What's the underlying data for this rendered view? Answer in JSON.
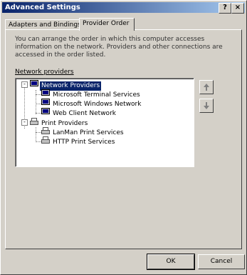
{
  "window": {
    "title": "Advanced Settings",
    "help_label": "?",
    "close_label": "×"
  },
  "tabs": [
    {
      "label": "Adapters and Bindings",
      "active": false
    },
    {
      "label": "Provider Order",
      "active": true
    }
  ],
  "description": "You can arrange the order in which this computer accesses information on the network. Providers and other connections are accessed in the order listed.",
  "list_label": "Network providers",
  "tree": {
    "groups": [
      {
        "label": "Network Providers",
        "expander": "-",
        "icon": "network-providers-icon",
        "selected": true,
        "children": [
          {
            "label": "Microsoft Terminal Services",
            "icon": "network-icon"
          },
          {
            "label": "Microsoft Windows Network",
            "icon": "network-icon"
          },
          {
            "label": "Web Client Network",
            "icon": "network-icon"
          }
        ]
      },
      {
        "label": "Print Providers",
        "expander": "-",
        "icon": "printer-icon",
        "selected": false,
        "children": [
          {
            "label": "LanMan Print Services",
            "icon": "printer-icon"
          },
          {
            "label": "HTTP Print Services",
            "icon": "printer-icon"
          }
        ]
      }
    ]
  },
  "move_up_icon": "arrow-up-icon",
  "move_down_icon": "arrow-down-icon",
  "buttons": {
    "ok": "OK",
    "cancel": "Cancel"
  }
}
